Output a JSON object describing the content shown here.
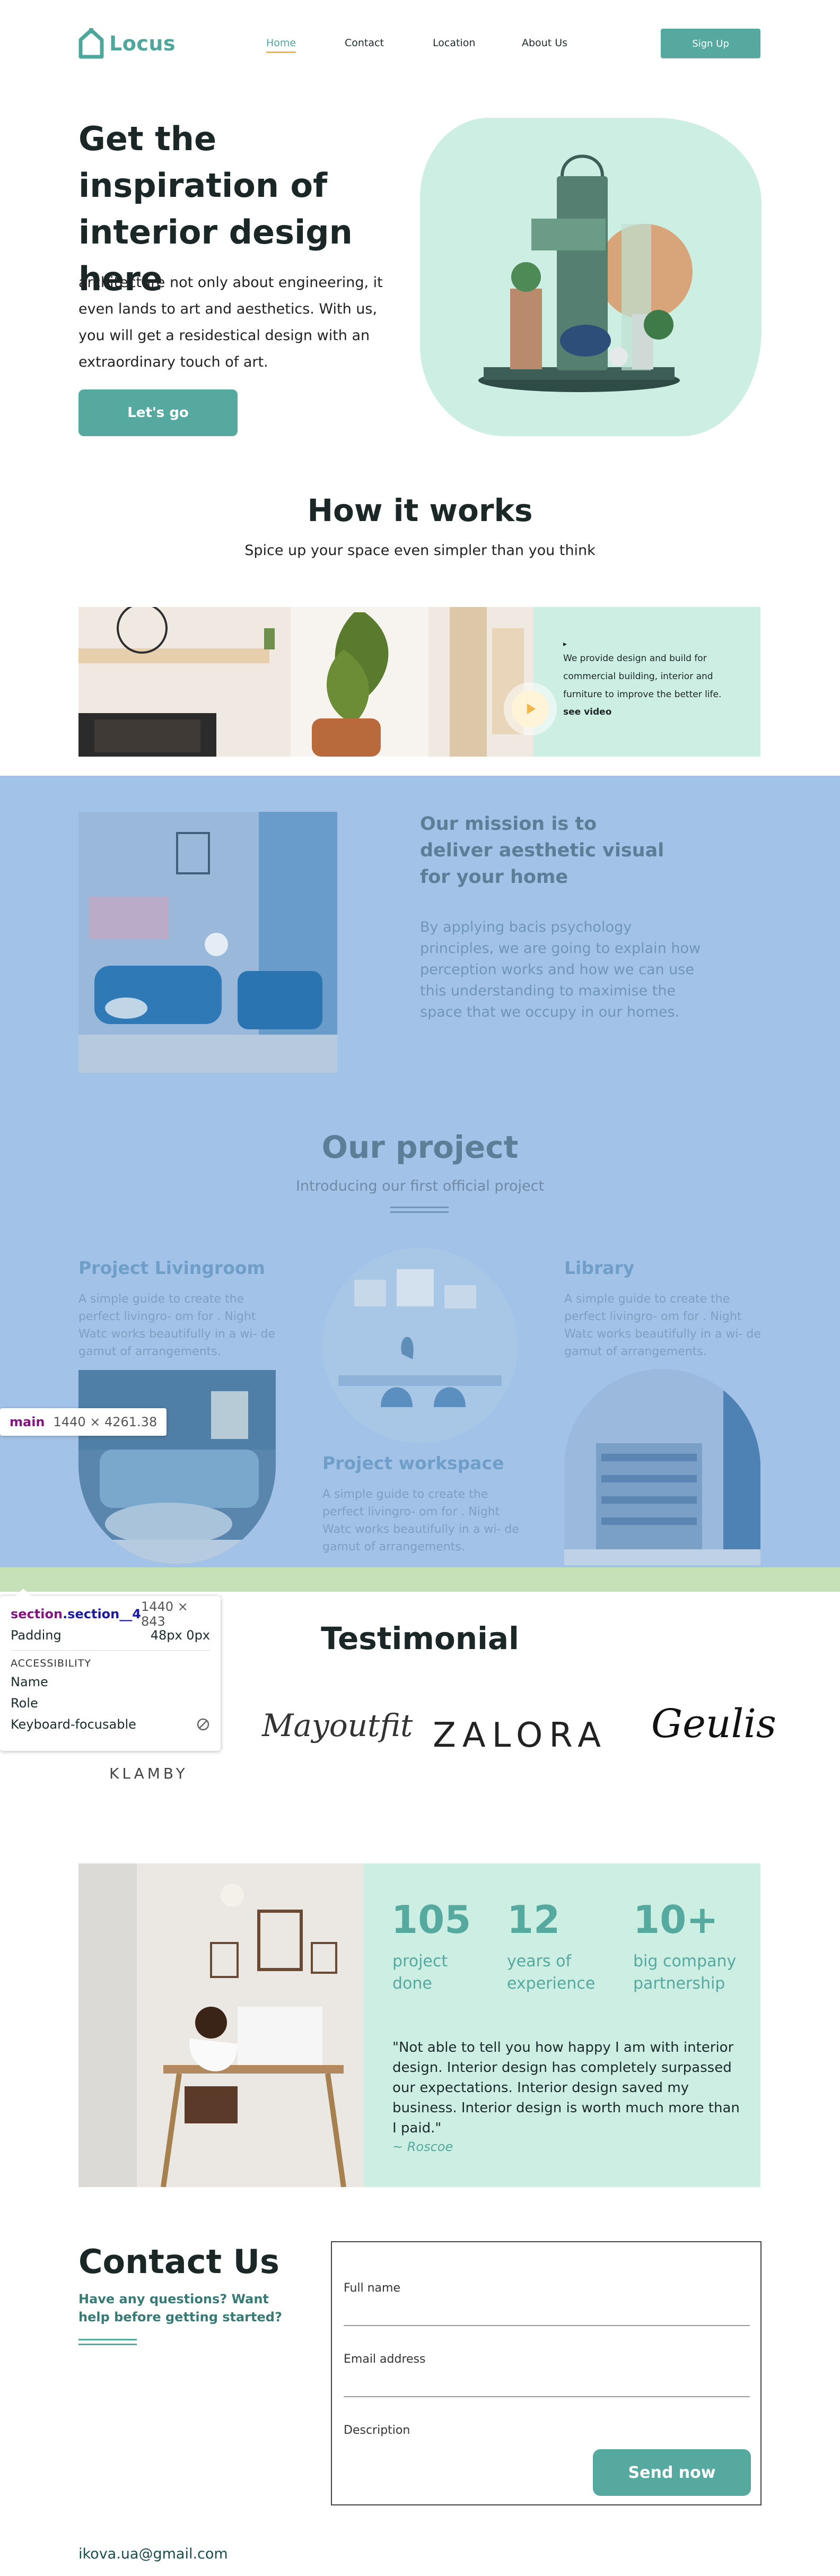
{
  "colors": {
    "accent": "#55a99e",
    "mint": "#cdeee3",
    "overlay_blue": "#a3c2e8",
    "underline": "#f0b64b"
  },
  "nav": {
    "logo": "Locus",
    "links": [
      "Home",
      "Contact",
      "Location",
      "About Us"
    ],
    "signup": "Sign Up"
  },
  "hero": {
    "title": "Get the inspiration of interior design here",
    "text": "architecture not only about engineering, it even lands to art and aesthetics. With us, you will get a residestical design with an extraordinary touch of art.",
    "button": "Let's go"
  },
  "how": {
    "title": "How it works",
    "subtitle": "Spice up your space even simpler than you think",
    "card_text": "We provide design and build for commercial building, interior and furniture to improve the better life.",
    "see_video": "see video"
  },
  "mission": {
    "title": "Our mission is to deliver aesthetic visual for your home",
    "text": "By applying bacis psychology principles, we are going to explain how perception works and how we can use this understanding to maximise the space that we occupy in our homes."
  },
  "projects": {
    "title": "Our project",
    "subtitle": "Introducing our first official project",
    "items": [
      {
        "title": "Project Livingroom",
        "text": "A simple guide to create the perfect livingro- om for . Night Watc works beautifully in a wi- de gamut of arrangements."
      },
      {
        "title": "Project workspace",
        "text": "A simple guide to create the perfect livingro- om for . Night Watc works beautifully in a wi- de gamut of arrangements."
      },
      {
        "title": "Library",
        "text": "A simple guide to create the perfect livingro- om for . Night Watc works beautifully in a wi- de gamut of arrangements."
      }
    ]
  },
  "inspector": {
    "main_name": "main",
    "main_dim": "1440 × 4261.38",
    "section_tag": "section",
    "section_class": ".section__4",
    "section_dim": "1440 × 843",
    "padding_label": "Padding",
    "padding_value": "48px 0px",
    "accessibility": "ACCESSIBILITY",
    "name_label": "Name",
    "role_label": "Role",
    "focus_label": "Keyboard-focusable"
  },
  "testimonial": {
    "title": "Testimonial",
    "brands": [
      "KLAMBY",
      "Mayoutfit",
      "ZALORA",
      "Geulis"
    ]
  },
  "stats": {
    "items": [
      {
        "num": "105",
        "l1": "project",
        "l2": "done"
      },
      {
        "num": "12",
        "l1": "years of",
        "l2": "experience"
      },
      {
        "num": "10+",
        "l1": "big company",
        "l2": "partnership"
      }
    ],
    "quote": "\"Not able to tell you how happy I am with interior design. Interior design has completely surpassed our expectations. Interior design saved my business. Interior design is worth much more than I paid.\"",
    "author": "~ Roscoe"
  },
  "contact": {
    "title": "Contact Us",
    "subtitle": "Have any questions? Want help before getting started?",
    "fields": [
      "Full name",
      "Email address",
      "Description"
    ],
    "send": "Send now",
    "email": "ikova.ua@gmail.com"
  }
}
